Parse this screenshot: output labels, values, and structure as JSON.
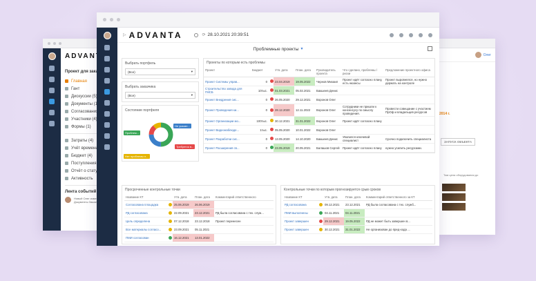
{
  "app": {
    "logo": "ADVANTA",
    "datetime": "28.10.2021 20:39:51",
    "page_title": "Проблемные проекты"
  },
  "left_window": {
    "logo": "ADVANTA",
    "title": "Проект для заказчика",
    "nav": [
      "Главная",
      "Гант",
      "Дискуссии (5)",
      "Документы (15)",
      "Согласования (5)",
      "Участники (4)",
      "Формы (1)"
    ],
    "nav2": [
      "Затраты (4)",
      "Учёт времени (15)",
      "Бюджет (4)",
      "Поступления (4)",
      "Отчёт о статусе Проекта",
      "Активность"
    ],
    "feed_title": "Лента событий",
    "feed_text": "Новый Олег изменил(а) (в) Поле в справочнике Актив в оплате Проекта Документы Заказчику рекомендация"
  },
  "right_window": {
    "user": "Олег",
    "orange_text": "2014 г.",
    "button": "ЗАПУСК ОБЪЕКТА",
    "note": "Там цена оборудования до"
  },
  "filters": {
    "portfolio_label": "Выбрать портфель",
    "portfolio_value": "(Все)",
    "customer_label": "Выбрать заказчика",
    "customer_value": "(Все)",
    "state_label": "Состояние портфеля"
  },
  "donut_labels": {
    "problem": "Проблем...",
    "at_risk": "Не указан...",
    "needs_attention": "Требуется в...",
    "no_problems": "Нет проблемы н..."
  },
  "projects_table": {
    "caption": "Проекты по которым есть проблемы",
    "headers": [
      "Проект",
      "Бюджет",
      "Утв. дата",
      "План. дата",
      "Руководитель проекта",
      "Что сделано, проблемы / риски",
      "Предложение проектного офиса"
    ],
    "rows": [
      {
        "name": "Проект Системы управ...",
        "budget": "0",
        "dot": "#e54848",
        "approved": "23.04.2019",
        "approved_cls": "d-red",
        "plan": "19.05.2022",
        "plan_cls": "d-green",
        "manager": "Чернов Михаил",
        "issues": "Проект идёт согласно плану, есть нюансы",
        "proposal": "Проект выровнялся, но нужно держать на контроле"
      },
      {
        "name": "Строительство завода для ГМСБ",
        "budget": "10тыс.",
        "dot": "#e54848",
        "approved": "01.03.2021",
        "approved_cls": "d-green",
        "plan": "05.02.2021",
        "plan_cls": "d-white",
        "manager": "Бакшеев Денис",
        "issues": "",
        "proposal": ""
      },
      {
        "name": "Проект Внедрения сис...",
        "budget": "0",
        "dot": "#e54848",
        "approved": "26.05.2020",
        "approved_cls": "d-white",
        "plan": "29.12.2021",
        "plan_cls": "d-white",
        "manager": "Воронов Олег",
        "issues": "",
        "proposal": ""
      },
      {
        "name": "Проект Проведения ки...",
        "budget": "0",
        "dot": "#e54848",
        "approved": "28.12.2020",
        "approved_cls": "d-red",
        "plan": "12.11.2022",
        "plan_cls": "d-white",
        "manager": "Воронов Олег",
        "issues": "Сотрудники не пришли к консенсусу по смыслу проведения.",
        "proposal": "Провести совещание с участием ПрОф и владельцев ресурсов"
      },
      {
        "name": "Проект Организации мо...",
        "budget": "100тыс.",
        "dot": "#e5b400",
        "approved": "30.12.2021",
        "approved_cls": "d-white",
        "plan": "31.01.2022",
        "plan_cls": "d-green",
        "manager": "Воронов Олег",
        "issues": "Проект идёт согласно плану",
        "proposal": ""
      },
      {
        "name": "Проект Видеонаблюде...",
        "budget": "1тыс.",
        "dot": "#e54848",
        "approved": "05.05.2020",
        "approved_cls": "d-white",
        "plan": "10.01.2022",
        "plan_cls": "d-white",
        "manager": "Воронов Олег",
        "issues": "",
        "proposal": ""
      },
      {
        "name": "Проект Разработки сис...",
        "budget": "0",
        "dot": "#e54848",
        "approved": "13.05.2020",
        "approved_cls": "d-white",
        "plan": "14.10.2020",
        "plan_cls": "d-white",
        "manager": "Бакшеев Денис",
        "issues": "Уволился ключевой специалист",
        "proposal": "Срочно подключить специалиста"
      },
      {
        "name": "Проект Расширения св...",
        "budget": "0",
        "dot": "#3aa657",
        "approved": "23.05.2019",
        "approved_cls": "d-green",
        "plan": "20.05.2021",
        "plan_cls": "d-white",
        "manager": "Балашов Сергей",
        "issues": "Проект идёт согласно плану",
        "proposal": "нужно усилить ресурсами."
      }
    ]
  },
  "milestones_left": {
    "caption": "Просроченные контрольные точки",
    "headers": [
      "Название КТ",
      "",
      "Утв. дата",
      "План. дата",
      "Комментарий ответственного"
    ],
    "rows": [
      {
        "name": "Согласована площадка",
        "dot": "#e5b400",
        "approved": "25.06.2019",
        "approved_cls": "d-red",
        "plan": "26.06.2019",
        "plan_cls": "d-red",
        "comment": ""
      },
      {
        "name": "РД согласована",
        "dot": "#e5b400",
        "approved": "22.09.2021",
        "approved_cls": "d-white",
        "plan": "23.12.2021",
        "plan_cls": "d-red",
        "comment": "РД была согласована с тех. служ..."
      },
      {
        "name": "Цель определена",
        "dot": "#e5b400",
        "approved": "07.12.2018",
        "approved_cls": "d-white",
        "plan": "23.12.2018",
        "plan_cls": "d-white",
        "comment": "Проект перенесен"
      },
      {
        "name": "Все материалы согласо...",
        "dot": "#e5b400",
        "approved": "23.09.2021",
        "approved_cls": "d-white",
        "plan": "05.11.2021",
        "plan_cls": "d-white",
        "comment": ""
      },
      {
        "name": "ПМИ согласован",
        "dot": "#3aa657",
        "approved": "16.12.2021",
        "approved_cls": "d-red",
        "plan": "13.01.2022",
        "plan_cls": "d-red",
        "comment": ""
      }
    ]
  },
  "milestones_right": {
    "caption": "Контрольные точки по которым прогнозируется срыв сроков",
    "headers": [
      "Название КТ",
      "",
      "Утв. дата",
      "План. дата",
      "Комментарий ответственного за КТ"
    ],
    "rows": [
      {
        "name": "РД согласована",
        "dot": "#e5b400",
        "approved": "09.12.2021",
        "approved_cls": "d-white",
        "plan": "23.12.2021",
        "plan_cls": "d-white",
        "comment": "РД была согласована с тех. служб..."
      },
      {
        "name": "ПМИ выполнены",
        "dot": "#3aa657",
        "approved": "04.11.2021",
        "approved_cls": "d-white",
        "plan": "04.11.2021",
        "plan_cls": "d-green",
        "comment": ""
      },
      {
        "name": "Проект завершен",
        "dot": "#e54848",
        "approved": "29.12.2021",
        "approved_cls": "d-red",
        "plan": "19.05.2022",
        "plan_cls": "d-green",
        "comment": "РД не может быть завершен в..."
      },
      {
        "name": "Проект завершен",
        "dot": "#e5b400",
        "approved": "30.12.2021",
        "approved_cls": "d-white",
        "plan": "31.01.2022",
        "plan_cls": "d-green",
        "comment": "Не организован до пред-хода ..."
      }
    ]
  },
  "colors": {
    "sidebar": "#1c2c44",
    "link": "#2f6fbf",
    "red": "#e54848",
    "yellow": "#e5b400",
    "green": "#3aa657",
    "accent": "#d31f3a"
  }
}
